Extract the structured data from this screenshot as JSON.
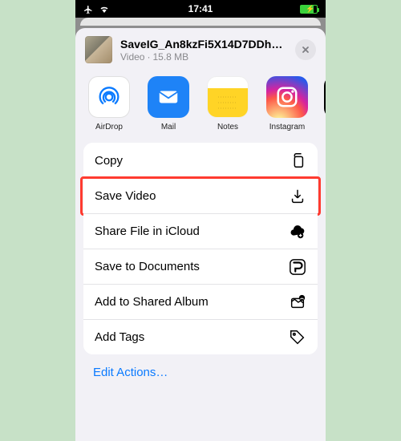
{
  "status": {
    "time": "17:41"
  },
  "file": {
    "name": "SaveIG_An8kzFi5X14D7DDhXM...",
    "kind": "Video",
    "size": "15.8 MB"
  },
  "shareTargets": {
    "airdrop": "AirDrop",
    "mail": "Mail",
    "notes": "Notes",
    "instagram": "Instagram"
  },
  "actions": {
    "copy": "Copy",
    "saveVideo": "Save Video",
    "shareIcloud": "Share File in iCloud",
    "saveDocs": "Save to Documents",
    "sharedAlbum": "Add to Shared Album",
    "addTags": "Add Tags"
  },
  "editActions": "Edit Actions…",
  "highlighted": "saveVideo"
}
